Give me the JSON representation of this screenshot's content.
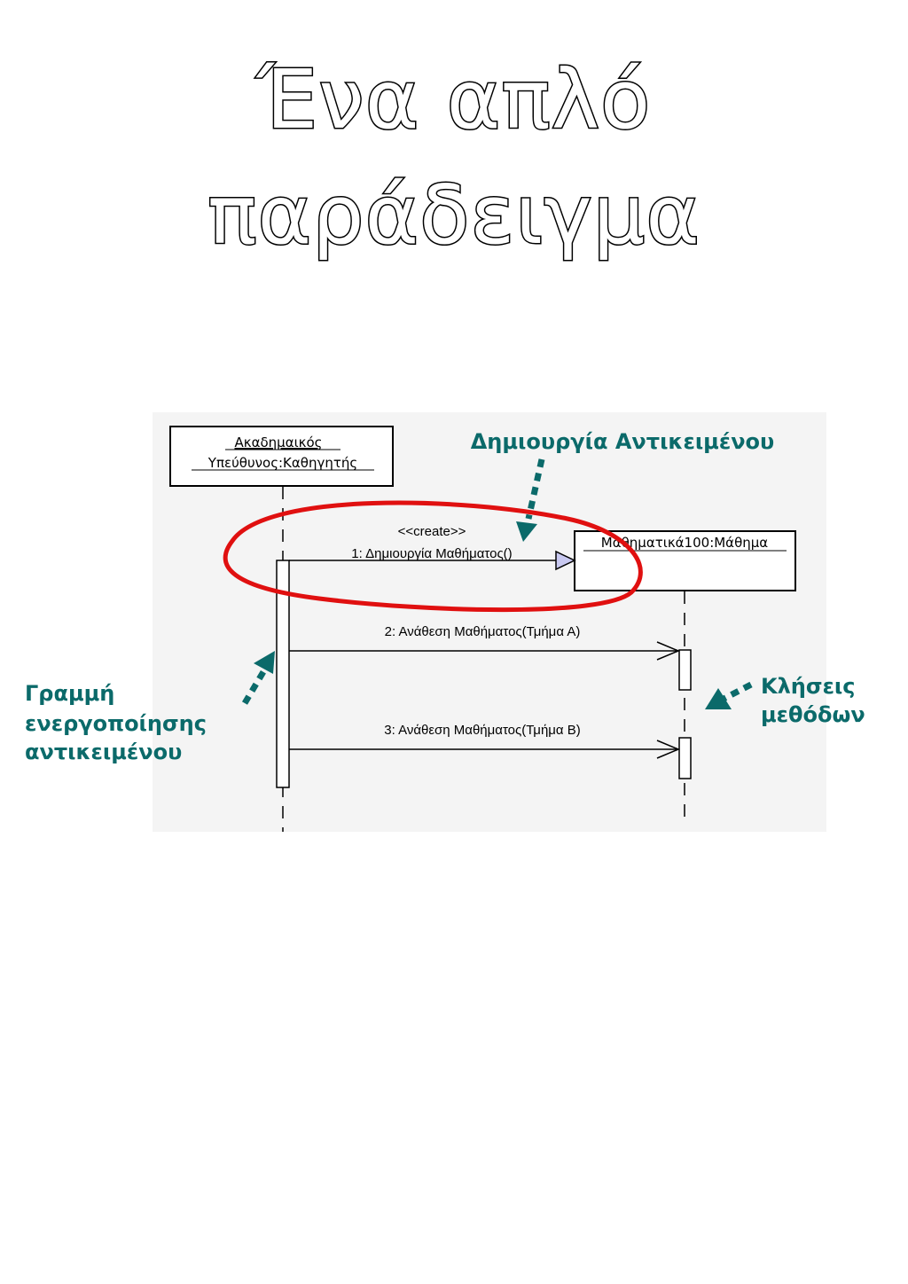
{
  "title": "Ένα απλό παράδειγμα",
  "diagram": {
    "objects": {
      "actor_line1": "Ακαδημαικός ",
      "actor_line2": "Υπεύθυνος:Καθηγητής",
      "target": "Μαθηματικά100:Μάθημα"
    },
    "messages": {
      "stereotype": "<<create>>",
      "m1": "1: Δημιουργία Μαθήματος()",
      "m2": "2: Ανάθεση Μαθήματος(Τμήμα Α)",
      "m3": "3: Ανάθεση Μαθήματος(Τμήμα Β)"
    },
    "annotations": {
      "create": "Δημιουργία Αντικειμένου",
      "activation_line1": "Γραμμή",
      "activation_line2": "ενεργοποίησης",
      "activation_line3": "αντικειμένου",
      "calls_line1": "Κλήσεις",
      "calls_line2": "μεθόδων"
    },
    "colors": {
      "annotation": "#0b6a6a",
      "highlight": "#e01010",
      "create_arrowhead": "#c8c8f0",
      "panel": "#f4f4f4"
    }
  }
}
